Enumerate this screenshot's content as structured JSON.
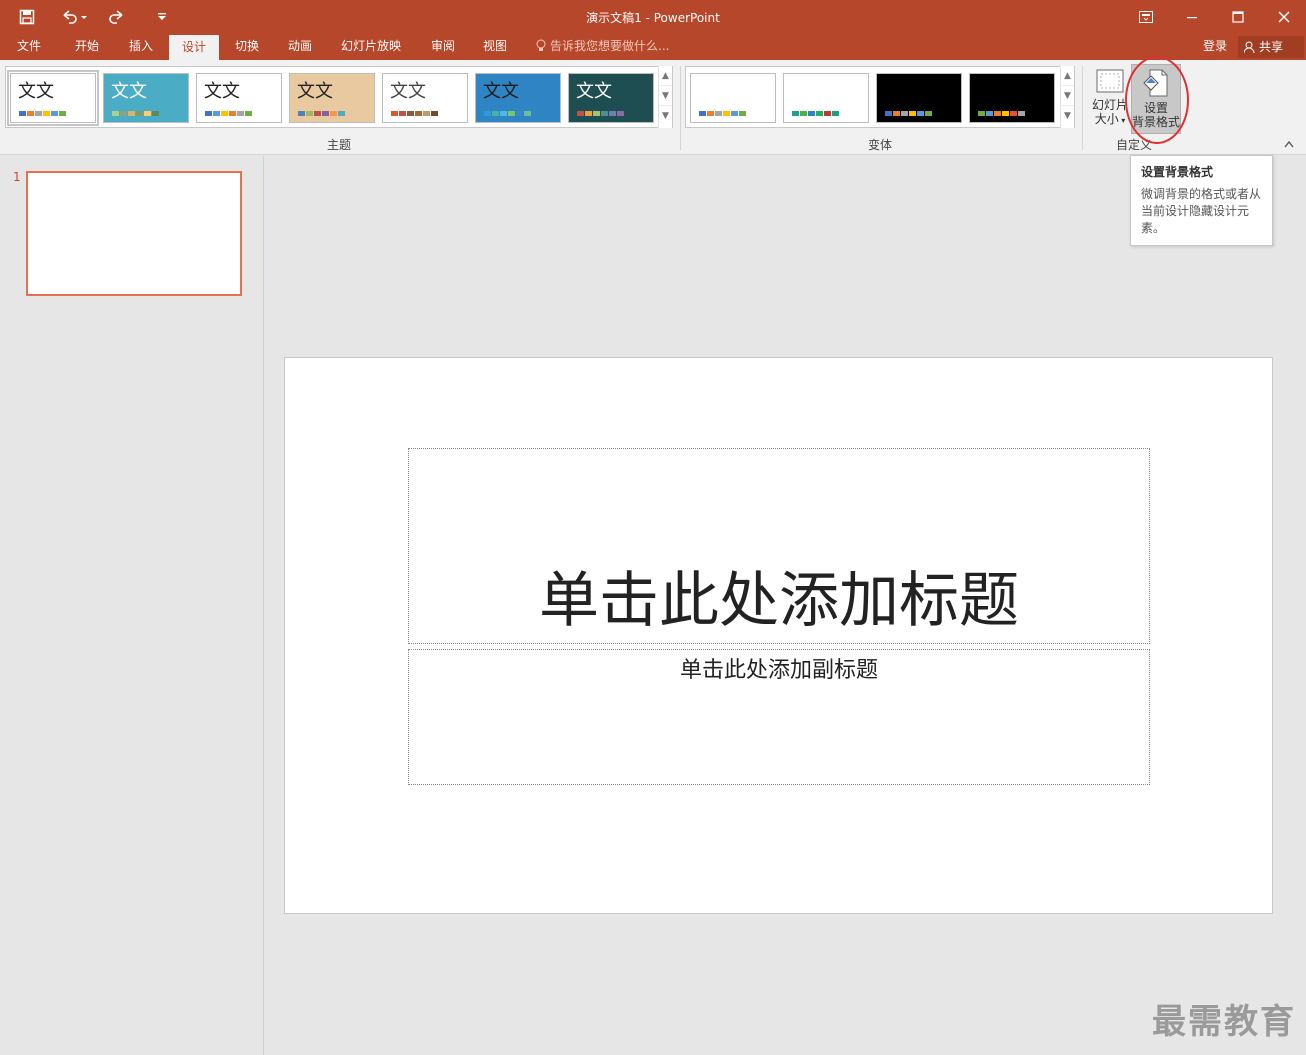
{
  "titlebar": {
    "doc_title": "演示文稿1 - PowerPoint",
    "qa_save_icon": "save-icon",
    "qa_undo_icon": "undo-icon",
    "qa_redo_icon": "redo-icon",
    "qa_customize_icon": "customize-quick-access-icon",
    "ribbon_options_icon": "ribbon-display-options-icon"
  },
  "tabs": [
    {
      "label": "文件"
    },
    {
      "label": "开始"
    },
    {
      "label": "插入"
    },
    {
      "label": "设计"
    },
    {
      "label": "切换"
    },
    {
      "label": "动画"
    },
    {
      "label": "幻灯片放映"
    },
    {
      "label": "审阅"
    },
    {
      "label": "视图"
    }
  ],
  "active_tab": "设计",
  "tell_me": "告诉我您想要做什么...",
  "signin": "登录",
  "share": "共享",
  "ribbon": {
    "themes_label": "主题",
    "variants_label": "变体",
    "customize_label": "自定义",
    "themes": [
      {
        "text": "文文",
        "bg": "#ffffff",
        "fg": "#222222",
        "swatches": [
          "#4472c4",
          "#ed7d31",
          "#a5a5a5",
          "#ffc000",
          "#5b9bd5",
          "#70ad47"
        ]
      },
      {
        "text": "文文",
        "bg": "#4bacc6",
        "fg": "#ffffff",
        "swatches": [
          "#a9d18e",
          "#8fa37a",
          "#d9b46b",
          "#7f9c66",
          "#ffcc66",
          "#5c8a5c"
        ]
      },
      {
        "text": "文文",
        "bg": "#ffffff",
        "fg": "#222222",
        "swatches": [
          "#4472c4",
          "#5b9bd5",
          "#ffc000",
          "#ed7d31",
          "#a5a5a5",
          "#70ad47"
        ]
      },
      {
        "text": "文文",
        "bg": "#e8c9a0",
        "fg": "#222222",
        "swatches": [
          "#4f81bd",
          "#9bbb59",
          "#c0504d",
          "#8064a2",
          "#f79646",
          "#4bacc6"
        ]
      },
      {
        "text": "文文",
        "bg": "#ffffff",
        "fg": "#444444",
        "swatches": [
          "#d75b2b",
          "#c0504d",
          "#8c5a3c",
          "#9e6b3a",
          "#c49a6c",
          "#6d4c30"
        ]
      },
      {
        "text": "文文",
        "bg": "#2f85c4",
        "fg": "#1a1a1a",
        "swatches": [
          "#2e9bd6",
          "#46b1a8",
          "#52b6e3",
          "#79c56c",
          "#3a86c7",
          "#6bbd9c"
        ]
      },
      {
        "text": "文文",
        "bg": "#1e4d52",
        "fg": "#ffffff",
        "swatches": [
          "#c0504d",
          "#e8a33c",
          "#a9c16f",
          "#4e8c8f",
          "#6d7fb3",
          "#8a6aa6"
        ]
      }
    ],
    "variants": [
      {
        "bg": "#ffffff",
        "swatches": [
          "#4472c4",
          "#ed7d31",
          "#a5a5a5",
          "#ffc000",
          "#5b9bd5",
          "#70ad47"
        ]
      },
      {
        "bg": "#ffffff",
        "swatches": [
          "#1f9e89",
          "#4caf50",
          "#2e86c1",
          "#27ae60",
          "#c0392b",
          "#16a085"
        ]
      },
      {
        "bg": "#000000",
        "swatches": [
          "#4472c4",
          "#ed7d31",
          "#a5a5a5",
          "#ffc000",
          "#5b9bd5",
          "#70ad47"
        ]
      },
      {
        "bg": "#000000",
        "swatches": [
          "#70ad47",
          "#5b9bd5",
          "#ed7d31",
          "#ffc000",
          "#e74c3c",
          "#a5a5a5"
        ]
      }
    ],
    "slide_size_label_1": "幻灯片",
    "slide_size_label_2": "大小",
    "format_bg_label_1": "设置",
    "format_bg_label_2": "背景格式"
  },
  "tooltip": {
    "title": "设置背景格式",
    "body": "微调背景的格式或者从当前设计隐藏设计元素。"
  },
  "thumbnails": [
    {
      "number": "1"
    }
  ],
  "slide": {
    "title_placeholder": "单击此处添加标题",
    "subtitle_placeholder": "单击此处添加副标题"
  },
  "watermark": "最需教育",
  "colors": {
    "accent": "#b7472a",
    "tab_active_text": "#b7472a",
    "thumb_border": "#e9704f",
    "annotation_circle": "#e03030"
  }
}
